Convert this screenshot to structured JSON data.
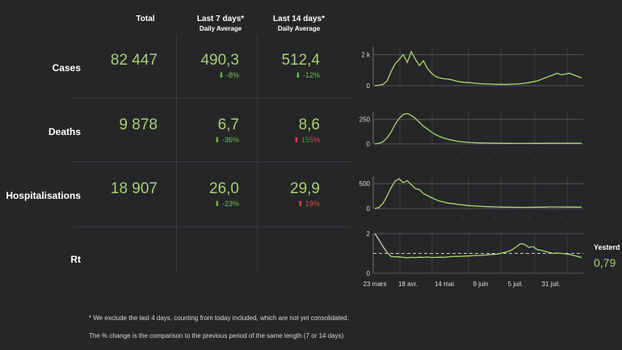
{
  "headers": {
    "total": "Total",
    "last7": "Last 7 days*",
    "last7_sub": "Daily Average",
    "last14": "Last 14 days*",
    "last14_sub": "Daily Average"
  },
  "rows": {
    "cases": {
      "label": "Cases",
      "total": "82 447",
      "avg7": "490,3",
      "chg7": "⬇ -8%",
      "avg14": "512,4",
      "chg14": "⬇ -12%"
    },
    "deaths": {
      "label": "Deaths",
      "total": "9 878",
      "avg7": "6,7",
      "chg7": "⬇ -36%",
      "avg14": "8,6",
      "chg14": "⬆ 155%"
    },
    "hosp": {
      "label": "Hospitalisations",
      "total": "18 907",
      "avg7": "26,0",
      "chg7": "⬇ -23%",
      "avg14": "29,9",
      "chg14": "⬆ 19%"
    },
    "rt": {
      "label": "Rt"
    }
  },
  "rt_side": {
    "label": "Yesterd",
    "value": "0,79"
  },
  "footnotes": {
    "line1": "* We exclude the last 4 days, counting from today included, which are not yet consolidated.",
    "line2": "The % change is the comparison to the previous period of the same length (7 or 14 days)"
  },
  "colors": {
    "positive": "#6fbf4f",
    "negative": "#e4474c",
    "line": "#a9d96a",
    "value": "#a9cf75"
  },
  "chart_data": [
    {
      "type": "line",
      "name": "cases",
      "y_ticks": [
        "0",
        "2 k"
      ],
      "ylim": [
        0,
        2500
      ],
      "x_ticks": [
        "23 mars",
        "18 avr.",
        "14 mai",
        "9 juin",
        "5 juil.",
        "31 juil."
      ],
      "series": [
        {
          "values": [
            0,
            30,
            80,
            300,
            900,
            1400,
            1700,
            2000,
            1500,
            2200,
            1700,
            1300,
            1600,
            1100,
            800,
            600,
            500,
            450,
            420,
            380,
            300,
            250,
            220,
            200,
            180,
            150,
            130,
            120,
            110,
            100,
            90,
            90,
            80,
            90,
            100,
            110,
            130,
            160,
            200,
            250,
            300,
            400,
            500,
            600,
            700,
            800,
            700,
            750,
            800,
            700,
            600,
            500
          ]
        }
      ]
    },
    {
      "type": "line",
      "name": "deaths",
      "y_ticks": [
        "0",
        "250"
      ],
      "ylim": [
        0,
        330
      ],
      "series": [
        {
          "values": [
            0,
            5,
            20,
            60,
            120,
            200,
            260,
            300,
            310,
            290,
            260,
            220,
            180,
            150,
            120,
            95,
            75,
            60,
            48,
            38,
            30,
            24,
            20,
            16,
            13,
            11,
            10,
            9,
            8,
            7,
            7,
            6,
            6,
            6,
            5,
            5,
            5,
            5,
            5,
            6,
            6,
            6,
            6,
            7,
            7,
            7,
            7,
            7,
            7,
            7,
            7,
            7
          ]
        }
      ]
    },
    {
      "type": "line",
      "name": "hospitalisations",
      "y_ticks": [
        "0",
        "500"
      ],
      "ylim": [
        0,
        650
      ],
      "series": [
        {
          "values": [
            0,
            20,
            100,
            250,
            420,
            550,
            600,
            520,
            560,
            480,
            400,
            380,
            300,
            260,
            220,
            180,
            150,
            130,
            110,
            100,
            90,
            80,
            70,
            60,
            55,
            50,
            45,
            40,
            38,
            35,
            32,
            30,
            28,
            27,
            26,
            25,
            24,
            24,
            25,
            26,
            27,
            28,
            30,
            32,
            33,
            32,
            31,
            30,
            30,
            29,
            28,
            27
          ]
        }
      ]
    },
    {
      "type": "line",
      "name": "rt",
      "y_ticks": [
        "0",
        "2"
      ],
      "ylim": [
        0,
        2
      ],
      "reference_line": 1,
      "series": [
        {
          "name": "rt",
          "values": [
            2,
            1.7,
            1.35,
            1.05,
            0.85,
            0.82,
            0.83,
            0.8,
            0.78,
            0.8,
            0.79,
            0.81,
            0.8,
            0.82,
            0.79,
            0.8,
            0.81,
            0.8,
            0.82,
            0.84,
            0.85,
            0.85,
            0.86,
            0.87,
            0.88,
            0.9,
            0.9,
            0.92,
            0.93,
            0.95,
            0.96,
            1.0,
            1.05,
            1.1,
            1.2,
            1.35,
            1.5,
            1.45,
            1.3,
            1.35,
            1.2,
            1.15,
            1.1,
            1.05,
            1.0,
            1.02,
            1.0,
            0.98,
            0.95,
            0.9,
            0.85,
            0.79
          ]
        }
      ]
    }
  ]
}
